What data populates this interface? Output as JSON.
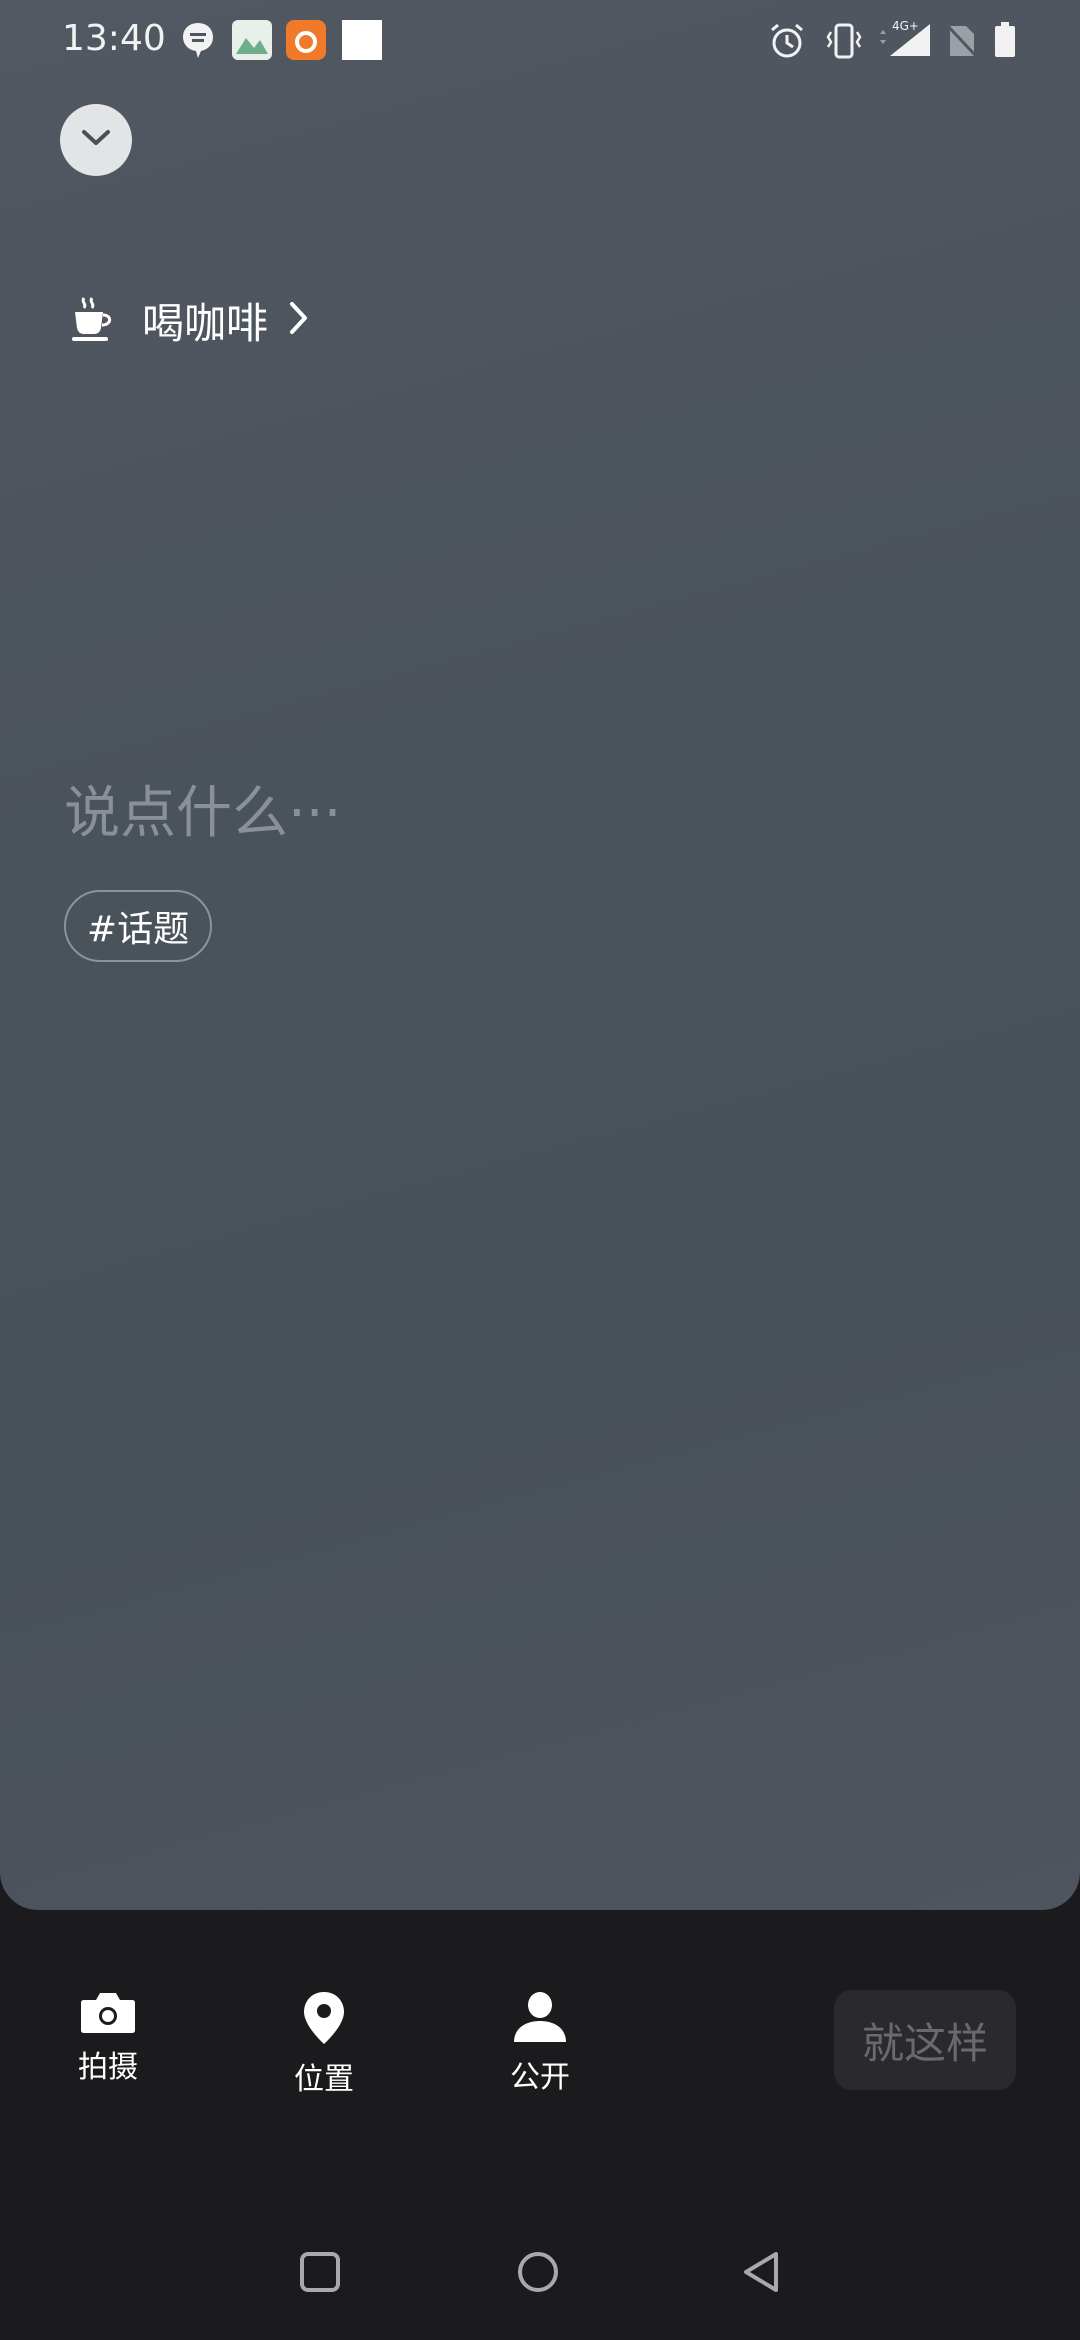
{
  "status_bar": {
    "time": "13:40",
    "network": "4G+",
    "notification_icons": [
      "message-icon",
      "gallery-app-icon",
      "uc-browser-icon",
      "blank-notification-icon"
    ],
    "system_icons": [
      "alarm-icon",
      "vibrate-icon",
      "signal-icon",
      "no-sim-icon",
      "battery-icon"
    ]
  },
  "header": {
    "collapse_icon": "chevron-down-icon"
  },
  "mood": {
    "icon": "coffee-cup-icon",
    "label": "喝咖啡"
  },
  "editor": {
    "placeholder": "说点什么···",
    "topic_tag": "#话题"
  },
  "toolbar": {
    "items": [
      {
        "icon": "camera-icon",
        "label": "拍摄"
      },
      {
        "icon": "location-pin-icon",
        "label": "位置"
      },
      {
        "icon": "person-icon",
        "label": "公开"
      }
    ],
    "submit_label": "就这样"
  },
  "nav_bar": {
    "buttons": [
      "recent-apps-button",
      "home-button",
      "back-button"
    ]
  },
  "colors": {
    "panel_bg": "#4c535c",
    "bottom_bg": "#1b1b1d",
    "placeholder_text": "#8a9097",
    "submit_disabled_bg": "#2a2a2d"
  }
}
